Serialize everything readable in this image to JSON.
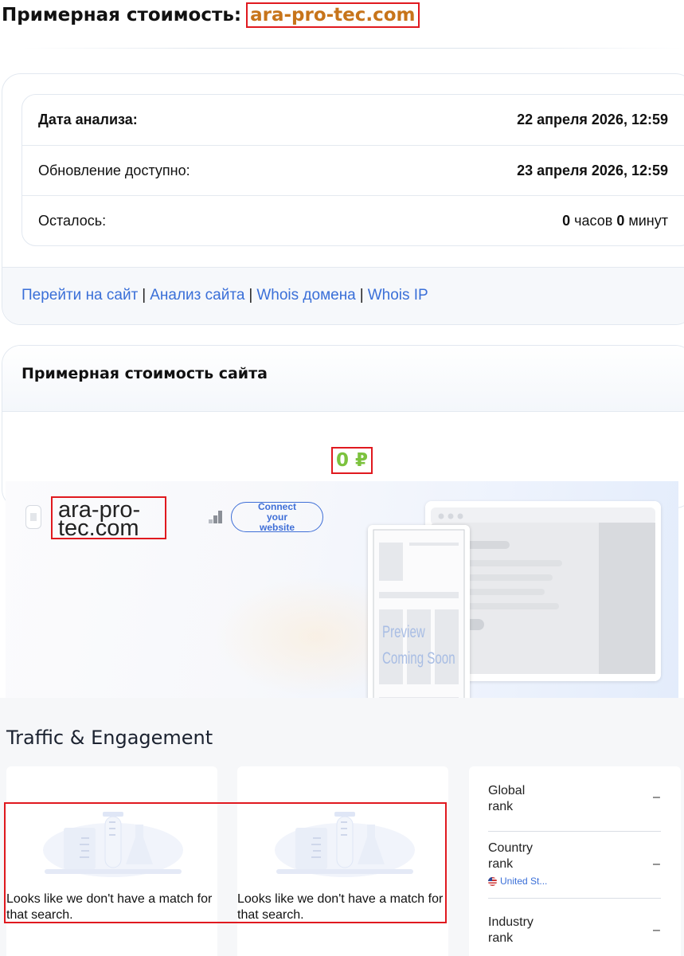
{
  "header": {
    "prefix": "Примерная стоимость:",
    "domain": "ara-pro-tec.com"
  },
  "analysis": {
    "rows": [
      {
        "label": "Дата анализа:",
        "value": "22 апреля 2026, 12:59"
      },
      {
        "label": "Обновление доступно:",
        "value": "23 апреля 2026, 12:59"
      }
    ],
    "remaining": {
      "label": "Осталось:",
      "hours": "0",
      "hours_unit": "часов",
      "minutes": "0",
      "minutes_unit": "минут"
    }
  },
  "links": [
    "Перейти на сайт",
    "Анализ сайта",
    "Whois домена",
    "Whois IP"
  ],
  "estimate": {
    "title": "Примерная стоимость сайта",
    "price": "0 ₽"
  },
  "widget": {
    "domain_line1": "ara-pro-",
    "domain_line2": "tec.com",
    "connect_label": "Connect your website",
    "preview_line1": "Preview",
    "preview_line2": "Coming Soon"
  },
  "traffic": {
    "title": "Traffic & Engagement",
    "no_match": "Looks like we don't have a match for that search.",
    "ranks": [
      {
        "label_line1": "Global",
        "label_line2": "rank",
        "value": "–"
      },
      {
        "label_line1": "Country",
        "label_line2": "rank",
        "value": "–",
        "sub": "United St..."
      },
      {
        "label_line1": "Industry",
        "label_line2": "rank",
        "value": "–"
      }
    ]
  },
  "colors": {
    "accent_blue": "#3a6fd8",
    "price_green": "#7cc23e",
    "domain_orange": "#c7741a",
    "highlight_red": "#e0191f"
  }
}
